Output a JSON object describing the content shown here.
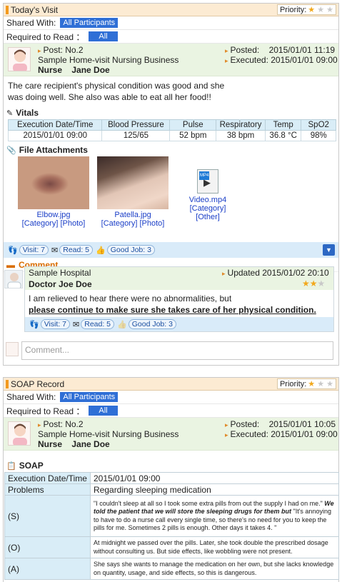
{
  "visit": {
    "title": "Today's Visit",
    "priority_label": "Priority:",
    "priority_stars": 1,
    "shared_label": "Shared With:",
    "shared_value": "All Participants",
    "required_label": "Required to Read ：",
    "required_value": "All",
    "post_no": "Post: No.2",
    "org": "Sample Home-visit Nursing Business",
    "role": "Nurse",
    "author": "Jane Doe",
    "posted_label": "Posted:",
    "posted_value": "2015/01/01 11:19",
    "executed_label": "Executed:",
    "executed_value": "2015/01/01 09:00",
    "text_line1": "The care recipient's physical condition was good and she",
    "text_line2": "was doing well. She also was able to eat all her food!!",
    "vitals_title": "Vitals",
    "vitals_headers": [
      "Execution Date/Time",
      "Blood Pressure",
      "Pulse",
      "Respiratory",
      "Temp",
      "SpO2"
    ],
    "vitals_values": [
      "2015/01/01 09:00",
      "125/65",
      "52 bpm",
      "38 bpm",
      "36.8 °C",
      "98%"
    ],
    "files_title": "File Attachments",
    "files": [
      {
        "name": "Elbow.jpg",
        "meta": "[Category] [Photo]"
      },
      {
        "name": "Patella.jpg",
        "meta": "[Category] [Photo]"
      },
      {
        "name": "Video.mp4",
        "meta": "[Category] [Other]",
        "badge": "MP4"
      }
    ],
    "reactions": {
      "visit": "Visit: 7",
      "read": "Read: 5",
      "good": "Good Job: 3"
    },
    "comment_title": "Comment",
    "comment": {
      "org": "Sample Hospital",
      "author": "Doctor Joe Doe",
      "updated_label": "Updated",
      "updated_value": "2015/01/02 20:10",
      "stars": 2,
      "line1": "I am relieved to hear there were no abnormalities, but",
      "line2": "please continue to make sure she takes care of her physical condition.",
      "reactions": {
        "visit": "Visit: 7",
        "read": "Read: 5",
        "good": "Good Job: 3"
      }
    },
    "comment_placeholder": "Comment..."
  },
  "soap": {
    "title": "SOAP Record",
    "priority_label": "Priority:",
    "priority_stars": 1,
    "shared_label": "Shared With:",
    "shared_value": "All Participants",
    "required_label": "Required to Read ：",
    "required_value": "All",
    "post_no": "Post: No.2",
    "org": "Sample Home-visit Nursing Business",
    "role": "Nurse",
    "author": "Jane Doe",
    "posted_label": "Posted:",
    "posted_value": "2015/01/01 10:05",
    "executed_label": "Executed:",
    "executed_value": "2015/01/01 09:00",
    "section_title": "SOAP",
    "exec_label": "Execution Date/Time",
    "exec_value": "2015/01/01 09:00",
    "problems_label": "Problems",
    "problems_value": "Regarding sleeping medication",
    "s_label": "(S)",
    "s_text_a": "\"I couldn't sleep at all so I took some extra pills from out the supply I had on me.\" ",
    "s_text_b": "We told the patient that we will store the sleeping drugs for them but",
    "s_text_c": " \"It's annoying to have to do a nurse call every single time, so there's no need for you to keep the pills for me. Sometimes 2 pills is enough. Other days it takes 4. \"",
    "o_label": "(O)",
    "o_text": "At midnight we passed over the pills. Later, she  took double the prescribed dosage without consulting us. But side effects, like wobbling were not present.",
    "a_label": "(A)",
    "a_text": "She says she wants to manage the medication on her own, but she lacks knowledge on quantity, usage, and side effects, so this is dangerous."
  }
}
